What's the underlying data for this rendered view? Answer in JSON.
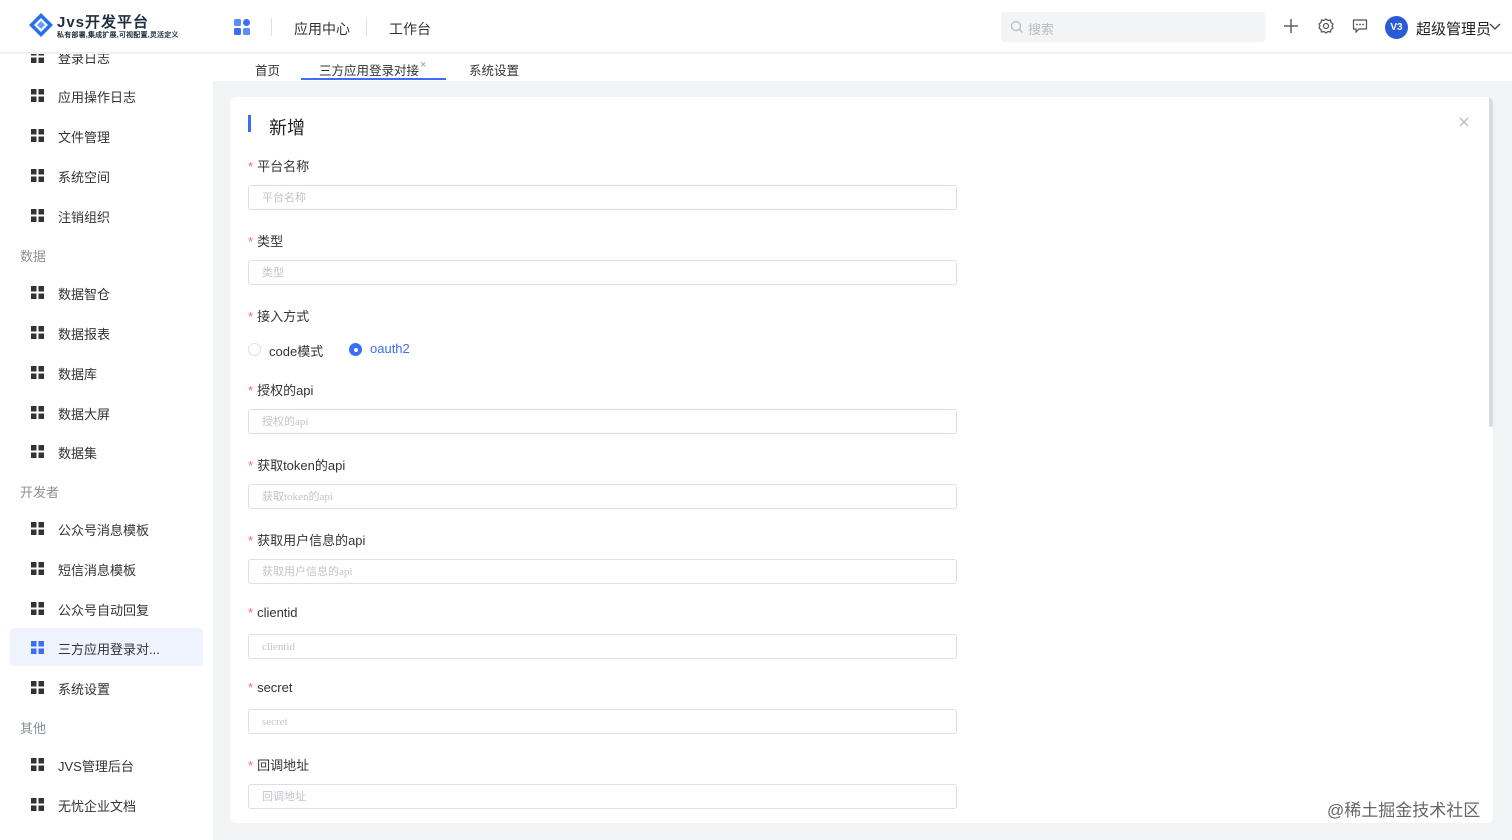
{
  "header": {
    "logo_title": "Jvs开发平台",
    "logo_subtitle": "私有部署,集成扩展,可视配置,灵活定义",
    "nav": [
      "应用中心",
      "工作台"
    ],
    "search_placeholder": "搜索",
    "user_initials": "V3",
    "user_name": "超级管理员"
  },
  "sidebar": {
    "items": [
      {
        "label": "登录日志"
      },
      {
        "label": "应用操作日志"
      },
      {
        "label": "文件管理"
      },
      {
        "label": "系统空间"
      },
      {
        "label": "注销组织"
      },
      {
        "group": "数据"
      },
      {
        "label": "数据智仓"
      },
      {
        "label": "数据报表"
      },
      {
        "label": "数据库"
      },
      {
        "label": "数据大屏"
      },
      {
        "label": "数据集"
      },
      {
        "group": "开发者"
      },
      {
        "label": "公众号消息模板"
      },
      {
        "label": "短信消息模板"
      },
      {
        "label": "公众号自动回复"
      },
      {
        "label": "三方应用登录对...",
        "active": true
      },
      {
        "label": "系统设置"
      },
      {
        "group": "其他"
      },
      {
        "label": "JVS管理后台"
      },
      {
        "label": "无忧企业文档"
      }
    ]
  },
  "tabs": {
    "items": [
      "首页",
      "三方应用登录对接",
      "系统设置"
    ],
    "active_index": 1,
    "close_glyph": "×"
  },
  "dialog": {
    "title": "新增",
    "fields": [
      {
        "label": "平台名称",
        "placeholder": "平台名称"
      },
      {
        "label": "类型",
        "placeholder": "类型"
      },
      {
        "label": "接入方式"
      },
      {
        "label": "授权的api",
        "placeholder": "授权的api"
      },
      {
        "label": "获取token的api",
        "placeholder": "获取token的api"
      },
      {
        "label": "获取用户信息的api",
        "placeholder": "获取用户信息的api"
      },
      {
        "label": "clientid",
        "placeholder": "clientid"
      },
      {
        "label": "secret",
        "placeholder": "secret"
      },
      {
        "label": "回调地址",
        "placeholder": "回调地址"
      }
    ],
    "required_mark": "*",
    "access_options": [
      {
        "label": "code模式",
        "checked": false
      },
      {
        "label": "oauth2",
        "checked": true
      }
    ]
  },
  "site_watermark": "@稀土掘金技术社区",
  "colors": {
    "accent": "#3b6ef5",
    "required": "#f56c6c",
    "sidebar_active_bg": "#eef3fd"
  }
}
